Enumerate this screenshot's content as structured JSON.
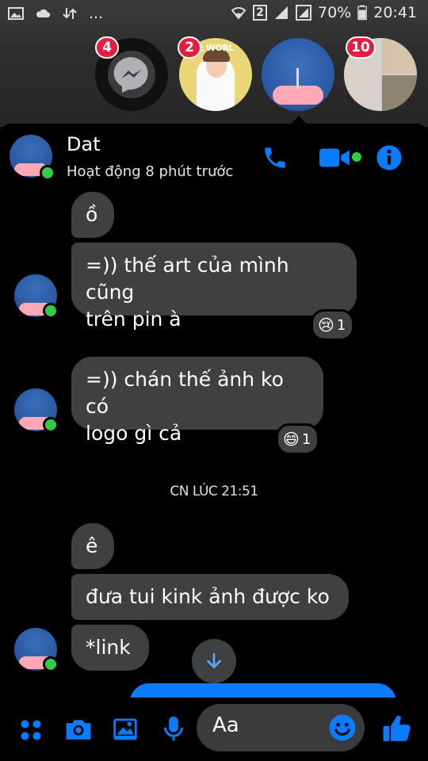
{
  "status_bar": {
    "battery_percent": "70%",
    "time": "20:41",
    "sim_slot": "2",
    "overflow": "..."
  },
  "chat_heads": [
    {
      "name": "messenger-head",
      "badge": "4"
    },
    {
      "name": "chat-head-photo",
      "badge": "2",
      "caption": "PE WORL"
    },
    {
      "name": "chat-head-active",
      "badge": ""
    },
    {
      "name": "chat-head-group",
      "badge": "10"
    }
  ],
  "header": {
    "contact_name": "Dat",
    "activity": "Hoạt động 8 phút trước"
  },
  "messages": [
    {
      "text_lines": [
        "ồ"
      ]
    },
    {
      "text_lines": [
        "=)) thế art của mình cũng",
        "trên pin à"
      ],
      "reaction": {
        "emoji": "😢",
        "count": "1"
      }
    },
    {
      "text_lines": [
        "=)) chán thế ảnh ko có",
        "logo gì cả"
      ],
      "reaction": {
        "emoji": "😄",
        "count": "1"
      }
    }
  ],
  "timestamp": "CN LÚC 21:51",
  "messages2": [
    {
      "text": "ê"
    },
    {
      "text": "đưa tui kink ảnh được ko"
    },
    {
      "text": "*link"
    }
  ],
  "composer": {
    "placeholder": "Aa"
  },
  "colors": {
    "accent": "#0a7cff",
    "online": "#31cc46",
    "badge": "#e41e3f",
    "bubble": "#3e4042"
  },
  "icons": [
    "phone-icon",
    "video-camera-icon",
    "info-icon",
    "menu-dots-icon",
    "camera-icon",
    "image-icon",
    "microphone-icon",
    "emoji-icon",
    "thumbs-up-icon",
    "arrow-down-icon"
  ]
}
